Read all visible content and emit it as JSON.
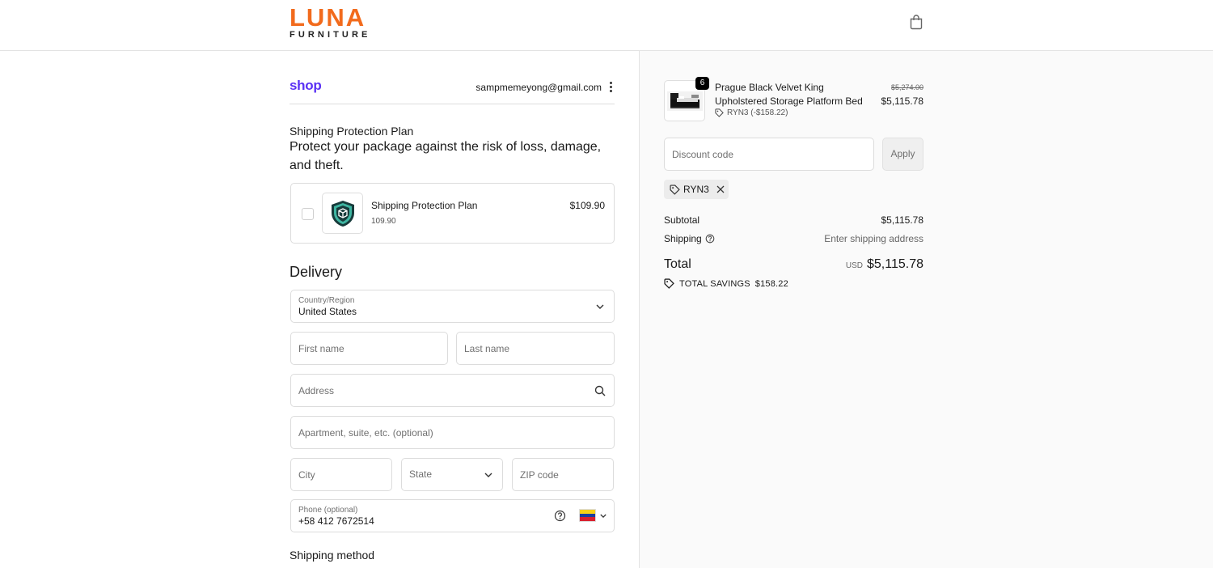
{
  "header": {
    "brand_top": "LUNA",
    "brand_bottom": "FURNITURE",
    "cart_icon": "shopping-bag-icon",
    "brand_color": "#f26b1d"
  },
  "account": {
    "shop_logo": "shop",
    "email": "sampmemeyong@gmail.com",
    "menu_icon": "kebab-icon",
    "shop_color": "#5a31f4"
  },
  "protection": {
    "title": "Shipping Protection Plan",
    "description": "Protect your package against the risk of loss, damage, and theft.",
    "item_name": "Shipping Protection Plan",
    "item_sub": "109.90",
    "item_price": "$109.90",
    "checked": false
  },
  "delivery": {
    "title": "Delivery",
    "country_label": "Country/Region",
    "country_value": "United States",
    "first_name_placeholder": "First name",
    "last_name_placeholder": "Last name",
    "address_placeholder": "Address",
    "apartment_placeholder": "Apartment, suite, etc. (optional)",
    "city_placeholder": "City",
    "state_placeholder": "State",
    "zip_placeholder": "ZIP code",
    "phone_label": "Phone (optional)",
    "phone_value": "+58 412 7672514",
    "phone_flag": "venezuela-flag"
  },
  "shipping_method": {
    "title": "Shipping method"
  },
  "order": {
    "product": {
      "quantity": "6",
      "name": "Prague Black Velvet King Upholstered Storage Platform Bed",
      "discount": "RYN3 (-$158.22)",
      "original_price": "$5,274.00",
      "price": "$5,115.78"
    },
    "discount_placeholder": "Discount code",
    "apply_label": "Apply",
    "applied_code": "RYN3",
    "subtotal_label": "Subtotal",
    "subtotal_value": "$5,115.78",
    "shipping_label": "Shipping",
    "shipping_value": "Enter shipping address",
    "total_label": "Total",
    "currency": "USD",
    "total_value": "$5,115.78",
    "savings_label": "TOTAL SAVINGS",
    "savings_value": "$158.22"
  }
}
